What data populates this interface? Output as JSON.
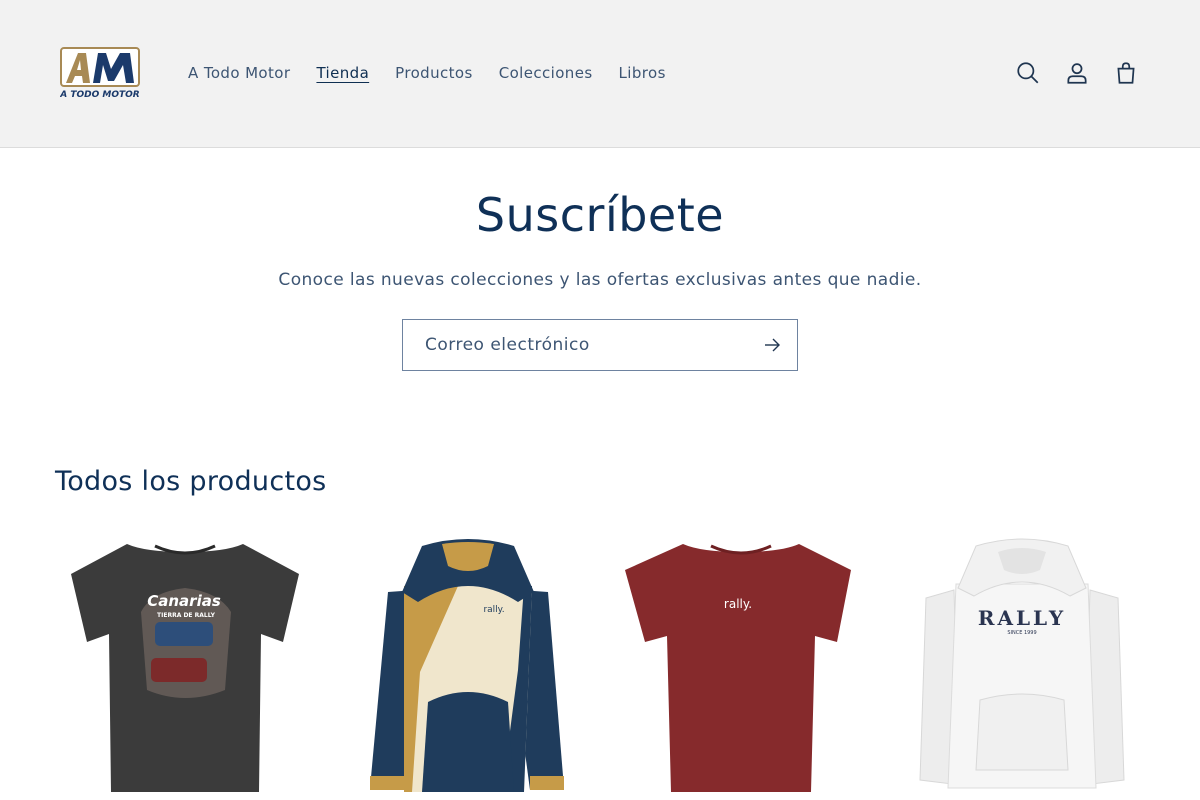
{
  "header": {
    "logo_text": "A TODO MOTOR",
    "logo_mark": "AM",
    "nav": [
      {
        "label": "A Todo Motor",
        "active": false
      },
      {
        "label": "Tienda",
        "active": true
      },
      {
        "label": "Productos",
        "active": false
      },
      {
        "label": "Colecciones",
        "active": false
      },
      {
        "label": "Libros",
        "active": false
      }
    ],
    "icons": [
      "search-icon",
      "account-icon",
      "cart-icon"
    ]
  },
  "subscribe": {
    "title": "Suscríbete",
    "text": "Conoce las nuevas colecciones y las ofertas exclusivas antes que nadie.",
    "email_placeholder": "Correo electrónico"
  },
  "products": {
    "title": "Todos los productos",
    "items": [
      {
        "image": "charcoal-tshirt-canarias-rally",
        "print_text": "Canarias",
        "print_subtext": "TIERRA DE RALLY",
        "color": "#3b3b3b"
      },
      {
        "image": "navy-cream-hoodie-rally",
        "print_text": "rally.",
        "color": "#1f3c5c"
      },
      {
        "image": "maroon-tshirt-rally",
        "print_text": "rally.",
        "color": "#862a2c"
      },
      {
        "image": "white-hoodie-rally",
        "print_text": "RALLY",
        "print_subtext": "SINCE 1999",
        "color": "#f4f4f4"
      }
    ]
  },
  "colors": {
    "header_bg": "#f2f2f2",
    "text_primary": "#0f3057",
    "text_secondary": "#3d5573",
    "logo_gold": "#a88a55",
    "logo_navy": "#1b3a6b"
  }
}
